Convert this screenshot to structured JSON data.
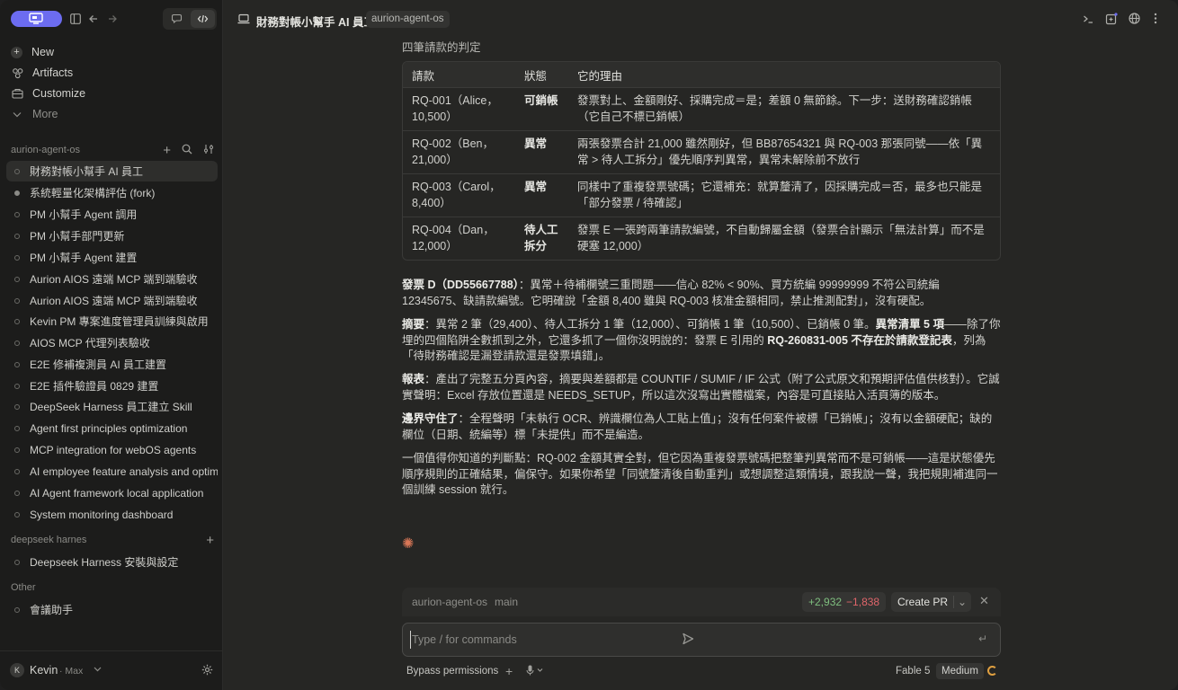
{
  "colors": {
    "accent": "#6c6cf0",
    "spark": "#d97757",
    "add": "#7fbf7f",
    "del": "#e0656a"
  },
  "sidebar": {
    "nav": [
      {
        "label": "New",
        "icon": "plus-icon"
      },
      {
        "label": "Artifacts",
        "icon": "artifacts-icon"
      },
      {
        "label": "Customize",
        "icon": "customize-icon"
      },
      {
        "label": "More",
        "icon": "chevron-down-icon"
      }
    ],
    "groups": [
      {
        "name": "aurion-agent-os",
        "items": [
          "財務對帳小幫手 AI 員工",
          "系統輕量化架構評估 (fork)",
          "PM 小幫手 Agent 調用",
          "PM 小幫手部門更新",
          "PM 小幫手 Agent 建置",
          "Aurion AIOS 遠端 MCP 端到端驗收",
          "Aurion AIOS 遠端 MCP 端到端驗收",
          "Kevin PM 專案進度管理員訓練與啟用",
          "AIOS MCP 代理列表驗收",
          "E2E 修補複測員 AI 員工建置",
          "E2E 插件驗證員 0829 建置",
          "DeepSeek Harness 員工建立 Skill",
          "Agent first principles optimization",
          "MCP integration for webOS agents",
          "AI employee feature analysis and optimization",
          "AI Agent framework local application",
          "System monitoring dashboard"
        ]
      },
      {
        "name": "deepseek harnes",
        "items": [
          "Deepseek Harness 安裝與設定"
        ]
      },
      {
        "name": "Other",
        "items": [
          "會議助手"
        ]
      }
    ],
    "user": {
      "initial": "K",
      "name": "Kevin",
      "plan": "· Max"
    }
  },
  "header": {
    "title": "財務對帳小幫手 AI 員工",
    "repo": "aurion-agent-os"
  },
  "main": {
    "section_heading": "四筆請款的判定",
    "table": {
      "headers": [
        "請款",
        "狀態",
        "它的理由"
      ],
      "rows": [
        [
          "RQ-001（Alice，10,500）",
          "可銷帳",
          "發票對上、金額剛好、採購完成＝是；差額 0 無節餘。下一步：送財務確認銷帳（它自己不標已銷帳）"
        ],
        [
          "RQ-002（Ben，21,000）",
          "異常",
          "兩張發票合計 21,000 雖然剛好，但 BB87654321 與 RQ-003 那張同號——依「異常 > 待人工拆分」優先順序判異常，異常未解除前不放行"
        ],
        [
          "RQ-003（Carol，8,400）",
          "異常",
          "同樣中了重複發票號碼；它還補充：就算釐清了，因採購完成＝否，最多也只能是「部分發票 / 待確認」"
        ],
        [
          "RQ-004（Dan，12,000）",
          "待人工拆分",
          "發票 E 一張跨兩筆請款編號，不自動歸屬金額（發票合計顯示「無法計算」而不是硬塞 12,000）"
        ]
      ]
    },
    "paragraphs": [
      {
        "lead": "發票 D（DD55667788）",
        "text": "：異常＋待補欄號三重問題——信心 82% < 90%、買方統編 99999999 不符公司統編 12345675、缺請款編號。它明確說「金額 8,400 雖與 RQ-003 核准金額相同，禁止推測配對」，沒有硬配。"
      },
      {
        "lead": "摘要",
        "text": "：異常 2 筆（29,400）、待人工拆分 1 筆（12,000）、可銷帳 1 筆（10,500）、已銷帳 0 筆。",
        "lead2": "異常清單 5 項",
        "text2": "——除了你埋的四個陷阱全數抓到之外，它還多抓了一個你沒明說的：發票 E 引用的 ",
        "lead3": "RQ-260831-005 不存在於請款登記表",
        "text3": "，列為「待財務確認是漏登請款還是發票填錯」。"
      },
      {
        "lead": "報表",
        "text": "：產出了完整五分頁內容，摘要與差額都是 COUNTIF / SUMIF / IF 公式（附了公式原文和預期評估值供核對）。它誠實聲明：Excel 存放位置還是 NEEDS_SETUP，所以這次沒寫出實體檔案，內容是可直接貼入活頁簿的版本。"
      },
      {
        "lead": "邊界守住了",
        "text": "：全程聲明「未執行 OCR、辨識欄位為人工貼上值」；沒有任何案件被標「已銷帳」；沒有以金額硬配；缺的欄位（日期、統編等）標「未提供」而不是編造。"
      },
      {
        "lead": "",
        "text": "一個值得你知道的判斷點：RQ-002 金額其實全對，但它因為重複發票號碼把整筆判異常而不是可銷帳——這是狀態優先順序規則的正確結果，偏保守。如果你希望「同號釐清後自動重判」或想調整這類情境，跟我說一聲，我把規則補進同一個訓練 session 就行。"
      }
    ]
  },
  "git": {
    "repo": "aurion-agent-os",
    "branch": "main",
    "added": "+2,932",
    "removed": "−1,838",
    "pr_label": "Create PR"
  },
  "composer": {
    "placeholder": "Type / for commands",
    "value": ""
  },
  "footer": {
    "permissions": "Bypass permissions",
    "model": "Fable 5",
    "effort": "Medium"
  }
}
